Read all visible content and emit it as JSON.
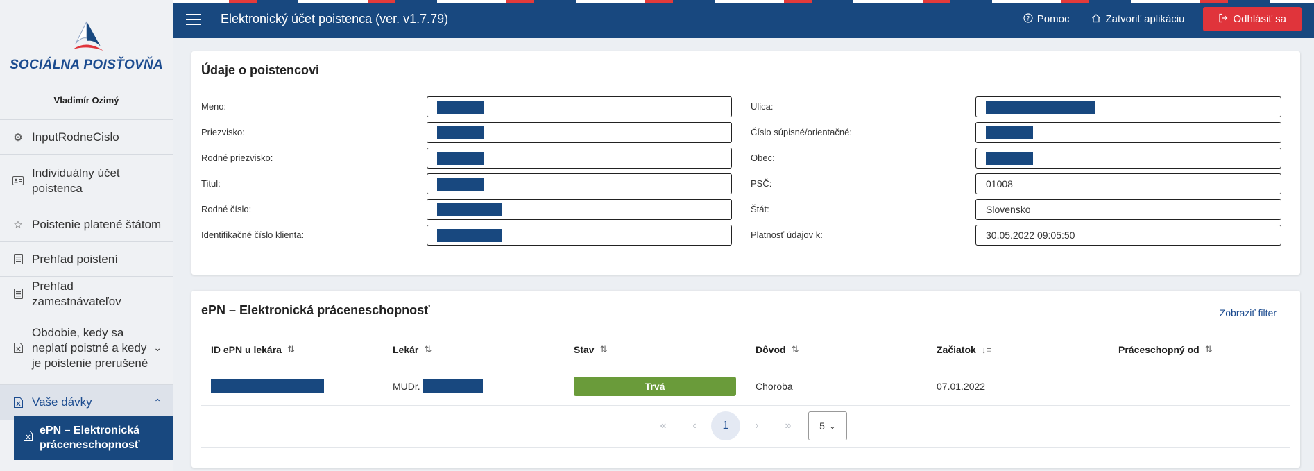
{
  "colors": {
    "brand": "#18487f",
    "danger": "#e0343b",
    "success": "#6a9b3a"
  },
  "sidebar": {
    "logo_text": "SOCIÁLNA POISŤOVŇA",
    "user_name": "Vladimír Ozimý",
    "items": [
      {
        "label": "InputRodneCislo",
        "icon": "gear-icon"
      },
      {
        "label": "Individuálny účet poistenca",
        "icon": "id-card-icon"
      },
      {
        "label": "Poistenie platené štátom",
        "icon": "star-icon"
      },
      {
        "label": "Prehľad poistení",
        "icon": "document-icon"
      },
      {
        "label": "Prehľad zamestnávateľov",
        "icon": "document-icon"
      },
      {
        "label": "Obdobie, kedy sa neplatí poistné a kedy je poistenie prerušené",
        "icon": "file-excel-icon"
      },
      {
        "label": "Vaše dávky",
        "icon": "file-excel-icon"
      }
    ],
    "active_sub": {
      "label": "ePN – Elektronická práceneschopnosť",
      "icon": "file-excel-icon"
    }
  },
  "header": {
    "title": "Elektronický účet poistenca (ver. v1.7.79)",
    "help": "Pomoc",
    "close_app": "Zatvoriť aplikáciu",
    "logout": "Odhlásiť sa"
  },
  "insured": {
    "title": "Údaje o poistencovi",
    "left_fields": [
      {
        "label": "Meno:",
        "value": ""
      },
      {
        "label": "Priezvisko:",
        "value": ""
      },
      {
        "label": "Rodné priezvisko:",
        "value": ""
      },
      {
        "label": "Titul:",
        "value": ""
      },
      {
        "label": "Rodné číslo:",
        "value": ""
      },
      {
        "label": "Identifikačné číslo klienta:",
        "value": ""
      }
    ],
    "right_fields": [
      {
        "label": "Ulica:",
        "value": ""
      },
      {
        "label": "Číslo súpisné/orientačné:",
        "value": ""
      },
      {
        "label": "Obec:",
        "value": ""
      },
      {
        "label": "PSČ:",
        "value": "01008"
      },
      {
        "label": "Štát:",
        "value": "Slovensko"
      },
      {
        "label": "Platnosť údajov k:",
        "value": "30.05.2022 09:05:50"
      }
    ]
  },
  "epn": {
    "title": "ePN – Elektronická práceneschopnosť",
    "filter_link": "Zobraziť filter",
    "columns": [
      "ID ePN u lekára",
      "Lekár",
      "Stav",
      "Dôvod",
      "Začiatok",
      "Práceschopný od"
    ],
    "rows": [
      {
        "id": "",
        "doctor_prefix": "MUDr.",
        "status": "Trvá",
        "reason": "Choroba",
        "start": "07.01.2022",
        "fit_from": ""
      }
    ],
    "pagination": {
      "first": "«",
      "prev": "‹",
      "current": "1",
      "next": "›",
      "last": "»",
      "page_size": "5"
    }
  }
}
